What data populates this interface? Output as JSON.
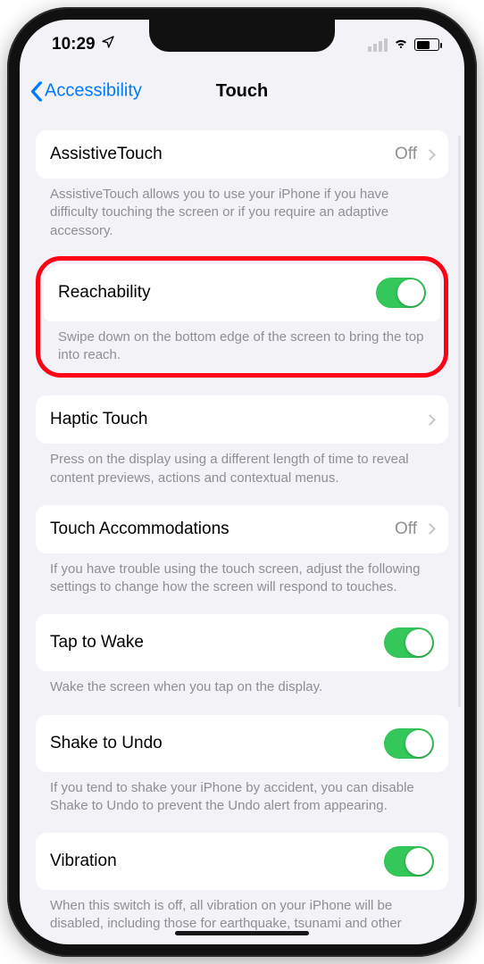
{
  "statusbar": {
    "time": "10:29"
  },
  "nav": {
    "back": "Accessibility",
    "title": "Touch"
  },
  "groups": {
    "assistive": {
      "label": "AssistiveTouch",
      "value": "Off",
      "footer": "AssistiveTouch allows you to use your iPhone if you have difficulty touching the screen or if you require an adaptive accessory."
    },
    "reachability": {
      "label": "Reachability",
      "on": true,
      "footer": "Swipe down on the bottom edge of the screen to bring the top into reach."
    },
    "haptic": {
      "label": "Haptic Touch",
      "footer": "Press on the display using a different length of time to reveal content previews, actions and contextual menus."
    },
    "accom": {
      "label": "Touch Accommodations",
      "value": "Off",
      "footer": "If you have trouble using the touch screen, adjust the following settings to change how the screen will respond to touches."
    },
    "tapwake": {
      "label": "Tap to Wake",
      "on": true,
      "footer": "Wake the screen when you tap on the display."
    },
    "shake": {
      "label": "Shake to Undo",
      "on": true,
      "footer": "If you tend to shake your iPhone by accident, you can disable Shake to Undo to prevent the Undo alert from appearing."
    },
    "vibration": {
      "label": "Vibration",
      "on": true,
      "footer": "When this switch is off, all vibration on your iPhone will be disabled, including those for earthquake, tsunami and other emergency alerts."
    }
  }
}
